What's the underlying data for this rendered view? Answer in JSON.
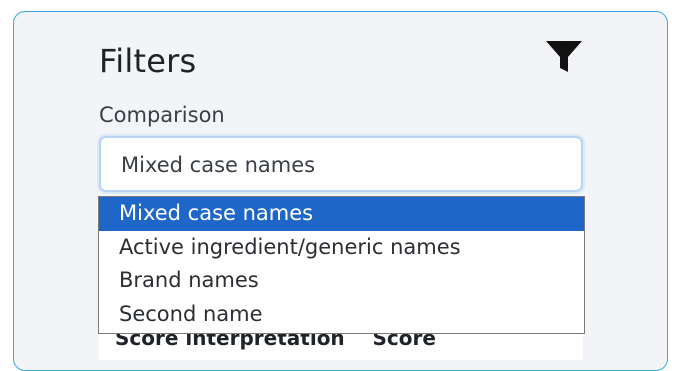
{
  "filters": {
    "title": "Filters",
    "filter_icon": "filter-funnel-icon",
    "comparison": {
      "label": "Comparison",
      "selected_value": "Mixed case names",
      "options": [
        {
          "label": "Mixed case names",
          "selected": true
        },
        {
          "label": "Active ingredient/generic names",
          "selected": false
        },
        {
          "label": "Brand names",
          "selected": false
        },
        {
          "label": "Second name",
          "selected": false
        }
      ]
    },
    "table_header_partial": "Score interpretation    Score"
  },
  "colors": {
    "panel_border": "#3fa7d6",
    "panel_background": "#f2f4f8",
    "selected_option": "#1f66c9"
  }
}
